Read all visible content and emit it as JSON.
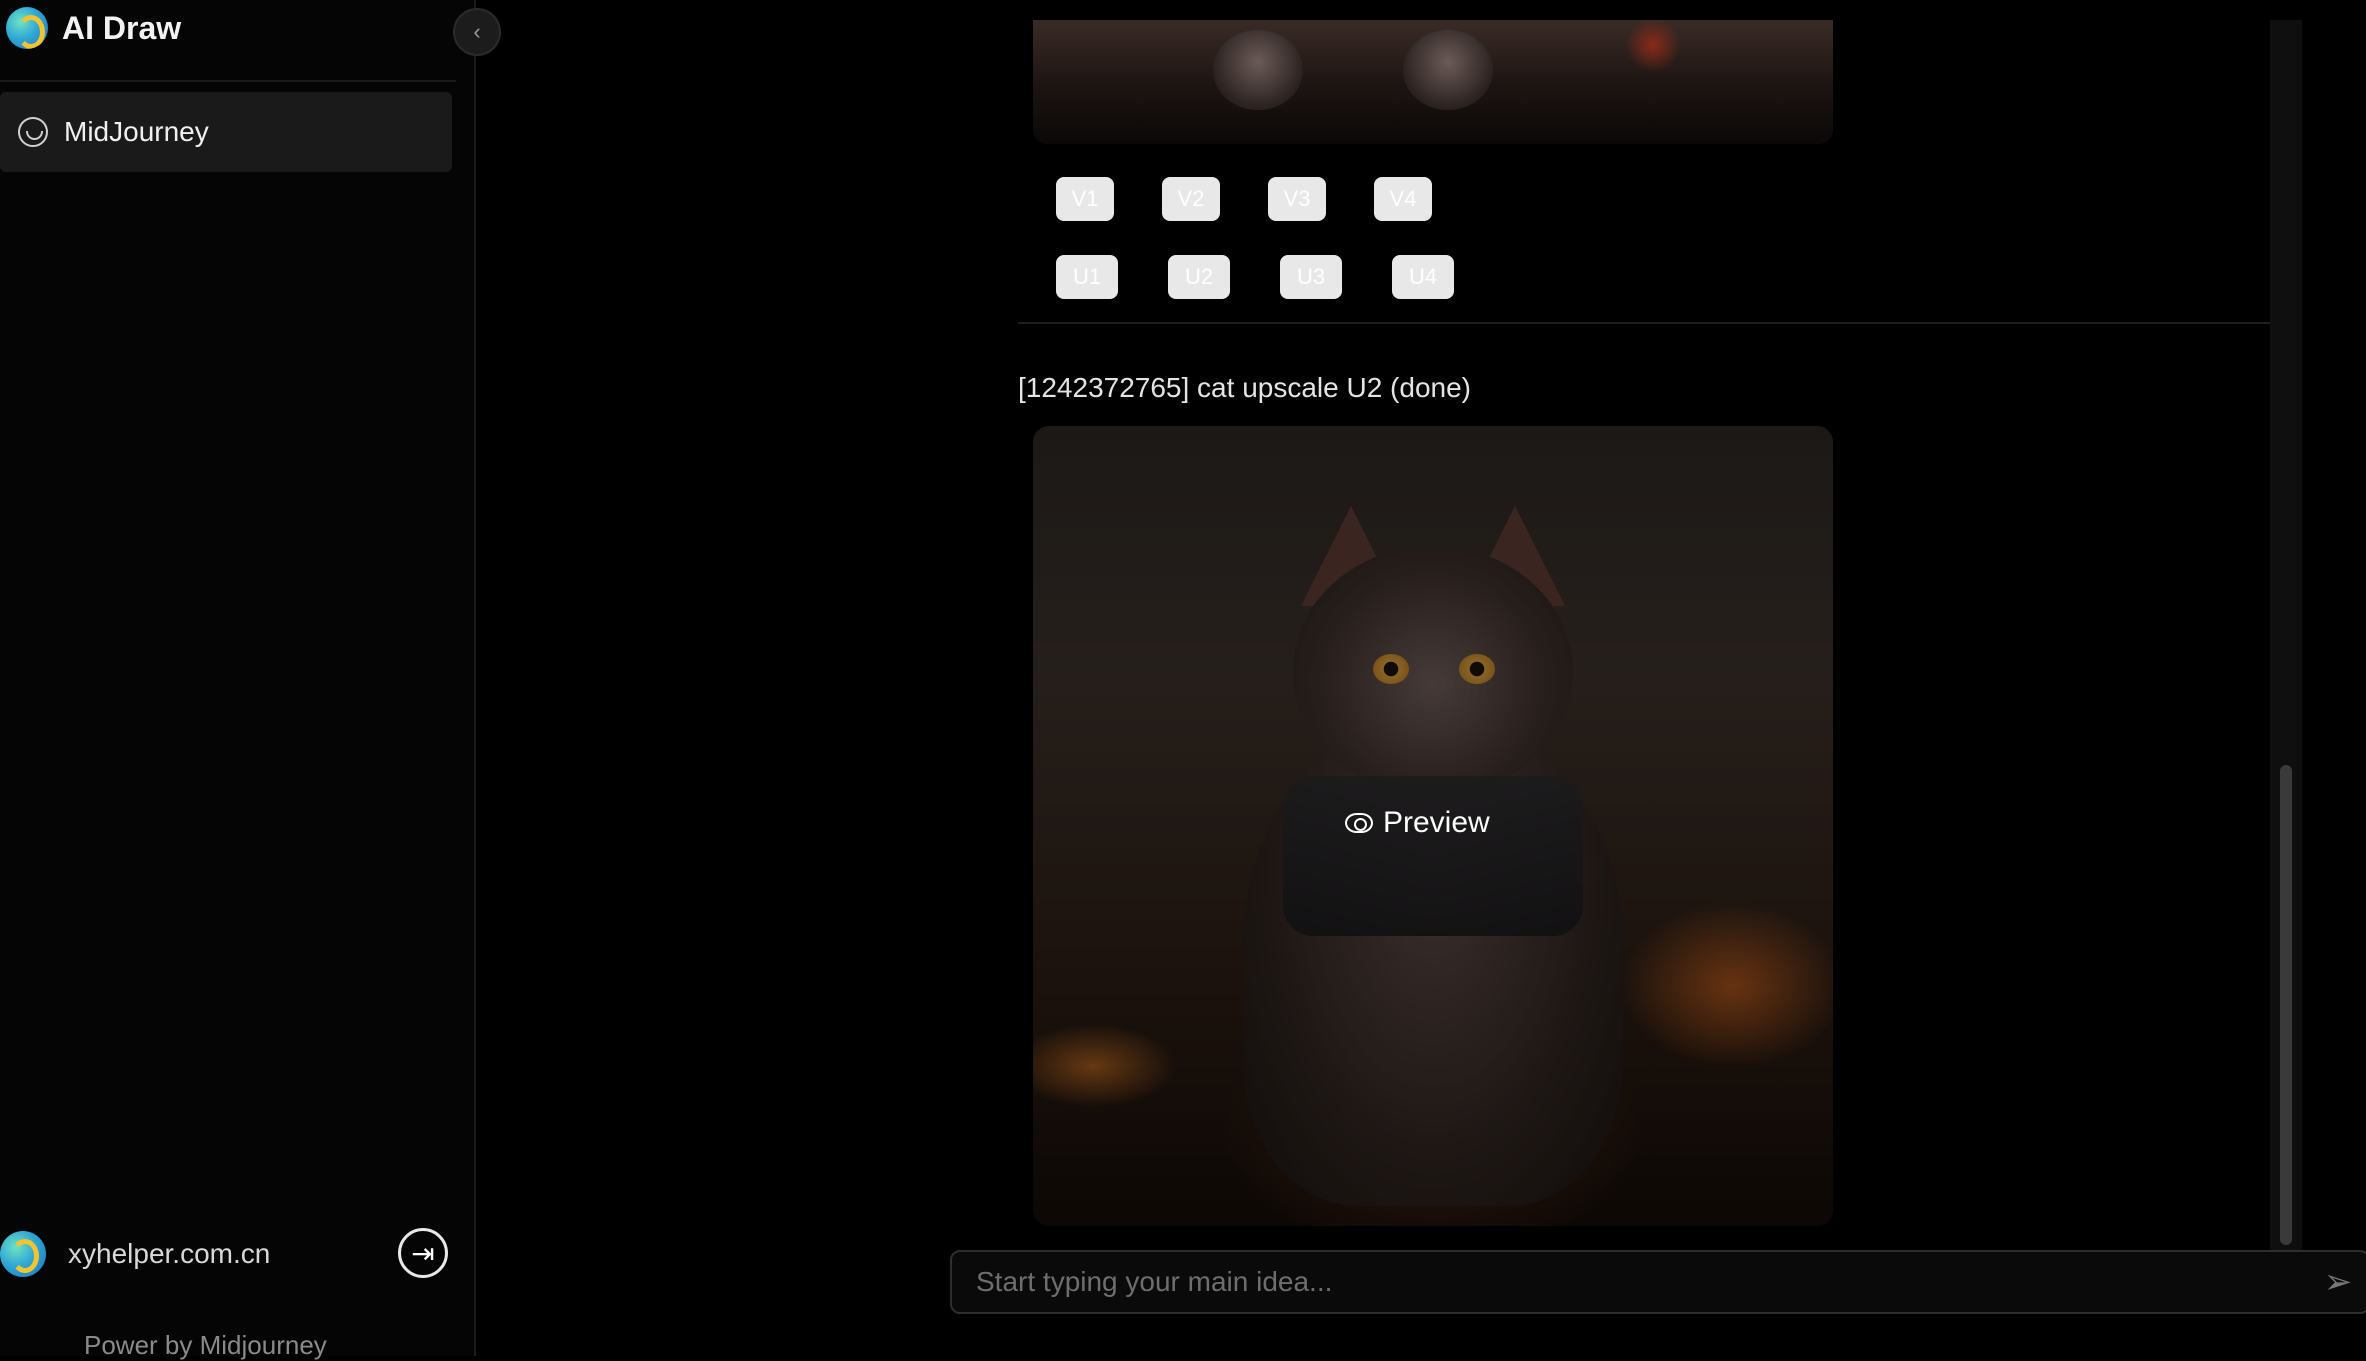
{
  "app": {
    "title": "AI Draw"
  },
  "sidebar": {
    "items": [
      {
        "label": "MidJourney",
        "icon": "smile-icon",
        "active": true
      }
    ],
    "footer": {
      "domain": "xyhelper.com.cn",
      "power_by": "Power by Midjourney"
    }
  },
  "feed": {
    "variation_buttons": [
      "V1",
      "V2",
      "V3",
      "V4"
    ],
    "upscale_buttons": [
      "U1",
      "U2",
      "U3",
      "U4"
    ],
    "message": "[1242372765] cat upscale U2 (done)",
    "preview_label": "Preview"
  },
  "prompt": {
    "placeholder": "Start typing your main idea..."
  },
  "colors": {
    "background": "#000000",
    "sidebar_bg": "#050505",
    "active_item_bg": "#1a1a1a",
    "button_bg": "#e8e8e8"
  }
}
